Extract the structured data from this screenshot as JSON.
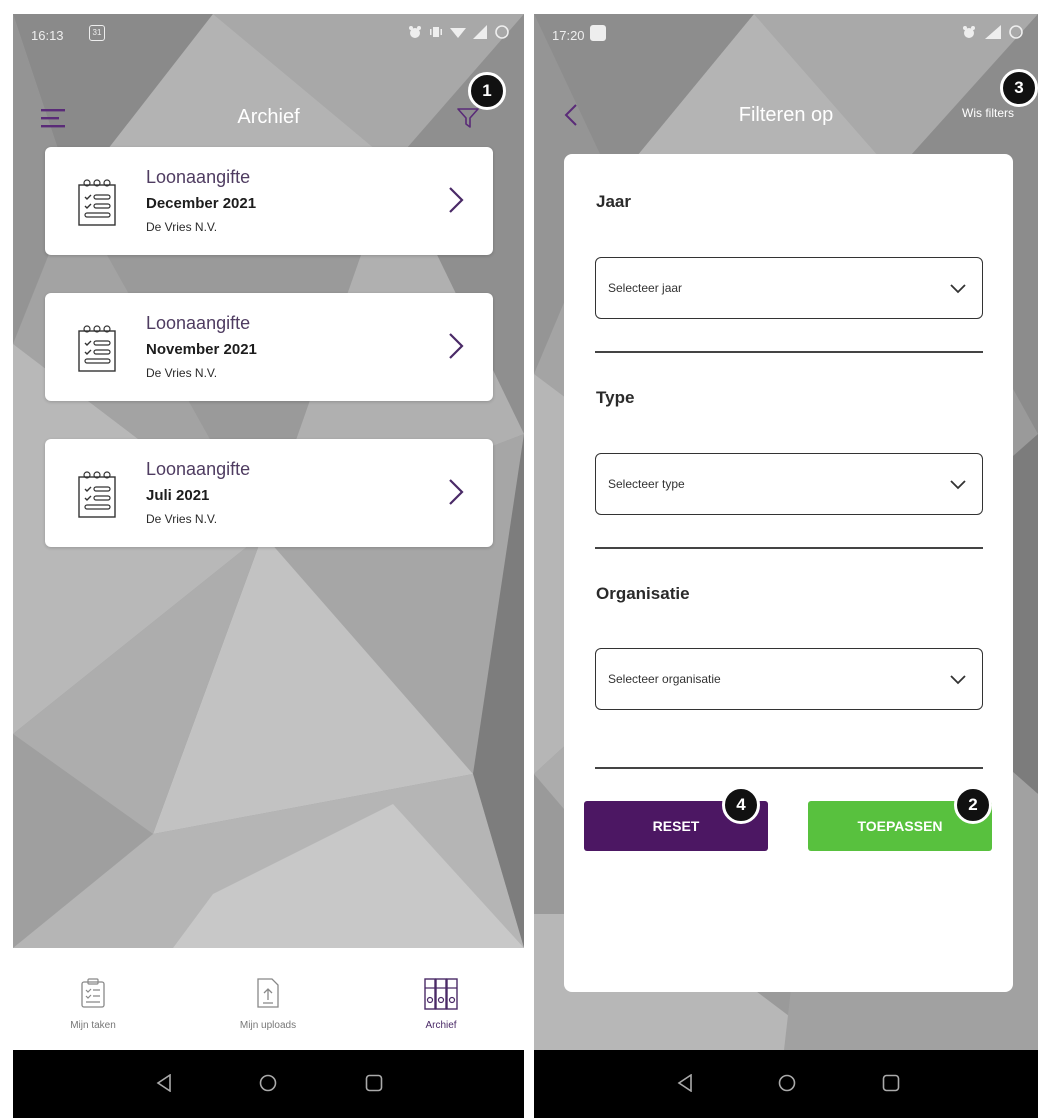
{
  "left": {
    "status": {
      "time": "16:13",
      "notif": "31"
    },
    "title": "Archief",
    "cards": [
      {
        "type": "Loonaangifte",
        "period": "December 2021",
        "org": "De Vries N.V."
      },
      {
        "type": "Loonaangifte",
        "period": "November 2021",
        "org": "De Vries N.V."
      },
      {
        "type": "Loonaangifte",
        "period": "Juli 2021",
        "org": "De Vries N.V."
      }
    ],
    "nav": {
      "tasks": "Mijn taken",
      "uploads": "Mijn uploads",
      "archive": "Archief"
    },
    "badge": "1"
  },
  "right": {
    "status": {
      "time": "17:20"
    },
    "title": "Filteren op",
    "clear_filters": "Wis filters",
    "sections": {
      "year": {
        "label": "Jaar",
        "placeholder": "Selecteer jaar"
      },
      "type": {
        "label": "Type",
        "placeholder": "Selecteer type"
      },
      "organisation": {
        "label": "Organisatie",
        "placeholder": "Selecteer organisatie"
      }
    },
    "reset": "RESET",
    "apply": "TOEPASSEN",
    "badges": {
      "apply": "2",
      "clear": "3",
      "reset": "4"
    }
  },
  "colors": {
    "brand_purple": "#4c1763",
    "apply_green": "#58c13e",
    "background_grey": "#9a9a9a"
  },
  "icons": [
    "menu-icon",
    "filter-icon",
    "back-icon",
    "clipboard-icon",
    "chevron-right-icon",
    "chevron-down-icon",
    "upload-icon",
    "archive-binders-icon",
    "alarm-icon",
    "vibrate-icon",
    "wifi-icon",
    "signal-icon",
    "battery-icon"
  ]
}
